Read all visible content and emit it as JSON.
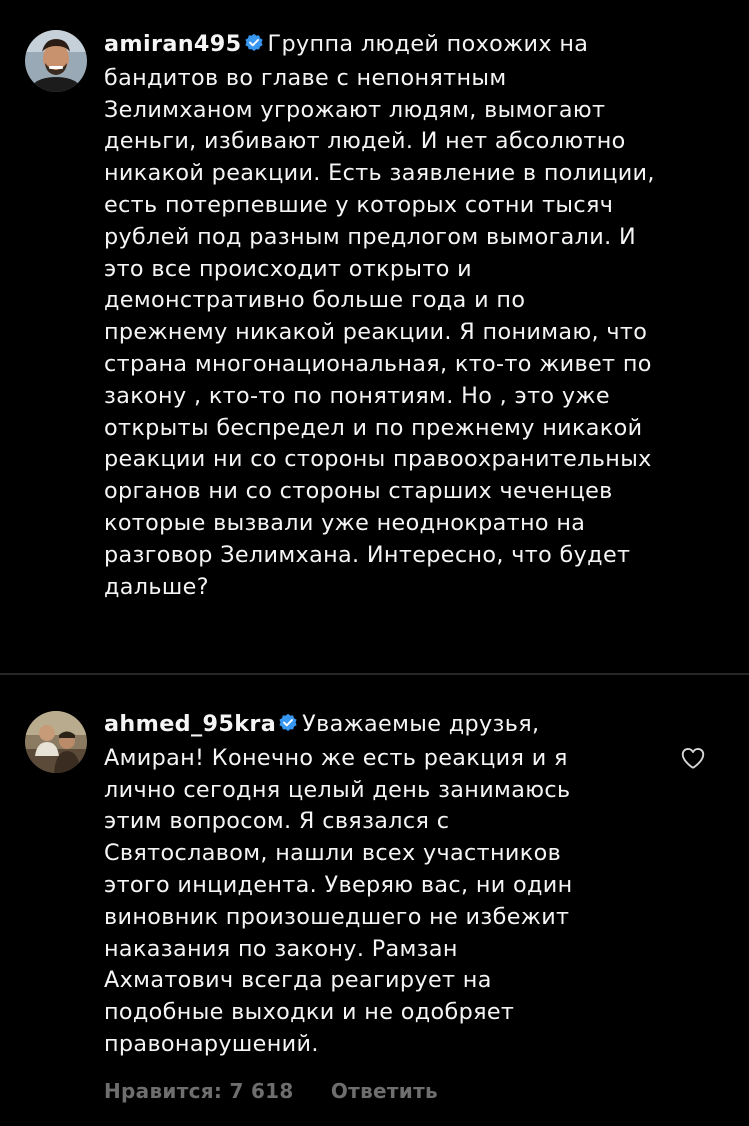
{
  "post": {
    "username": "amiran495",
    "lines": [
      "Группа людей похожих на",
      "бандитов во главе с непонятным",
      "Зелимханом угрожают людям, вымогают",
      "деньги, избивают людей. И нет абсолютно",
      "никакой реакции. Есть заявление в полиции,",
      "есть потерпевшие у которых сотни тысяч",
      "рублей под разным предлогом вымогали. И",
      "это все происходит открыто и",
      "демонстративно больше года и по",
      "прежнему никакой реакции. Я понимаю, что",
      "страна многонациональная, кто-то живет по",
      "закону , кто-то по понятиям. Но , это уже",
      "открыты беспредел и по прежнему никакой",
      "реакции ни со стороны правоохранительных",
      "органов ни со стороны старших чеченцев",
      "которые вызвали уже неоднократно на",
      "разговор Зелимхана. Интересно, что будет",
      "дальше?"
    ]
  },
  "reply": {
    "username": "ahmed_95kra",
    "lines": [
      "Уважаемые друзья,",
      "Амиран! Конечно же есть реакция и я",
      "лично сегодня целый день занимаюсь",
      "этим вопросом. Я связался с",
      "Святославом, нашли всех участников",
      "этого инцидента. Уверяю вас, ни один",
      "виновник произошедшего не избежит",
      "наказания по закону. Рамзан",
      "Ахматович всегда реагирует на",
      "подобные выходки и не одобряет",
      "правонарушений."
    ],
    "likes_label": "Нравится: 7 618",
    "reply_label": "Ответить"
  },
  "icons": {
    "verified": "verified-badge-icon",
    "like": "heart-outline-icon"
  },
  "colors": {
    "background": "#000000",
    "text": "#f5f5f5",
    "muted": "#6e6e6e",
    "verified": "#3897f0",
    "divider": "#262626"
  }
}
